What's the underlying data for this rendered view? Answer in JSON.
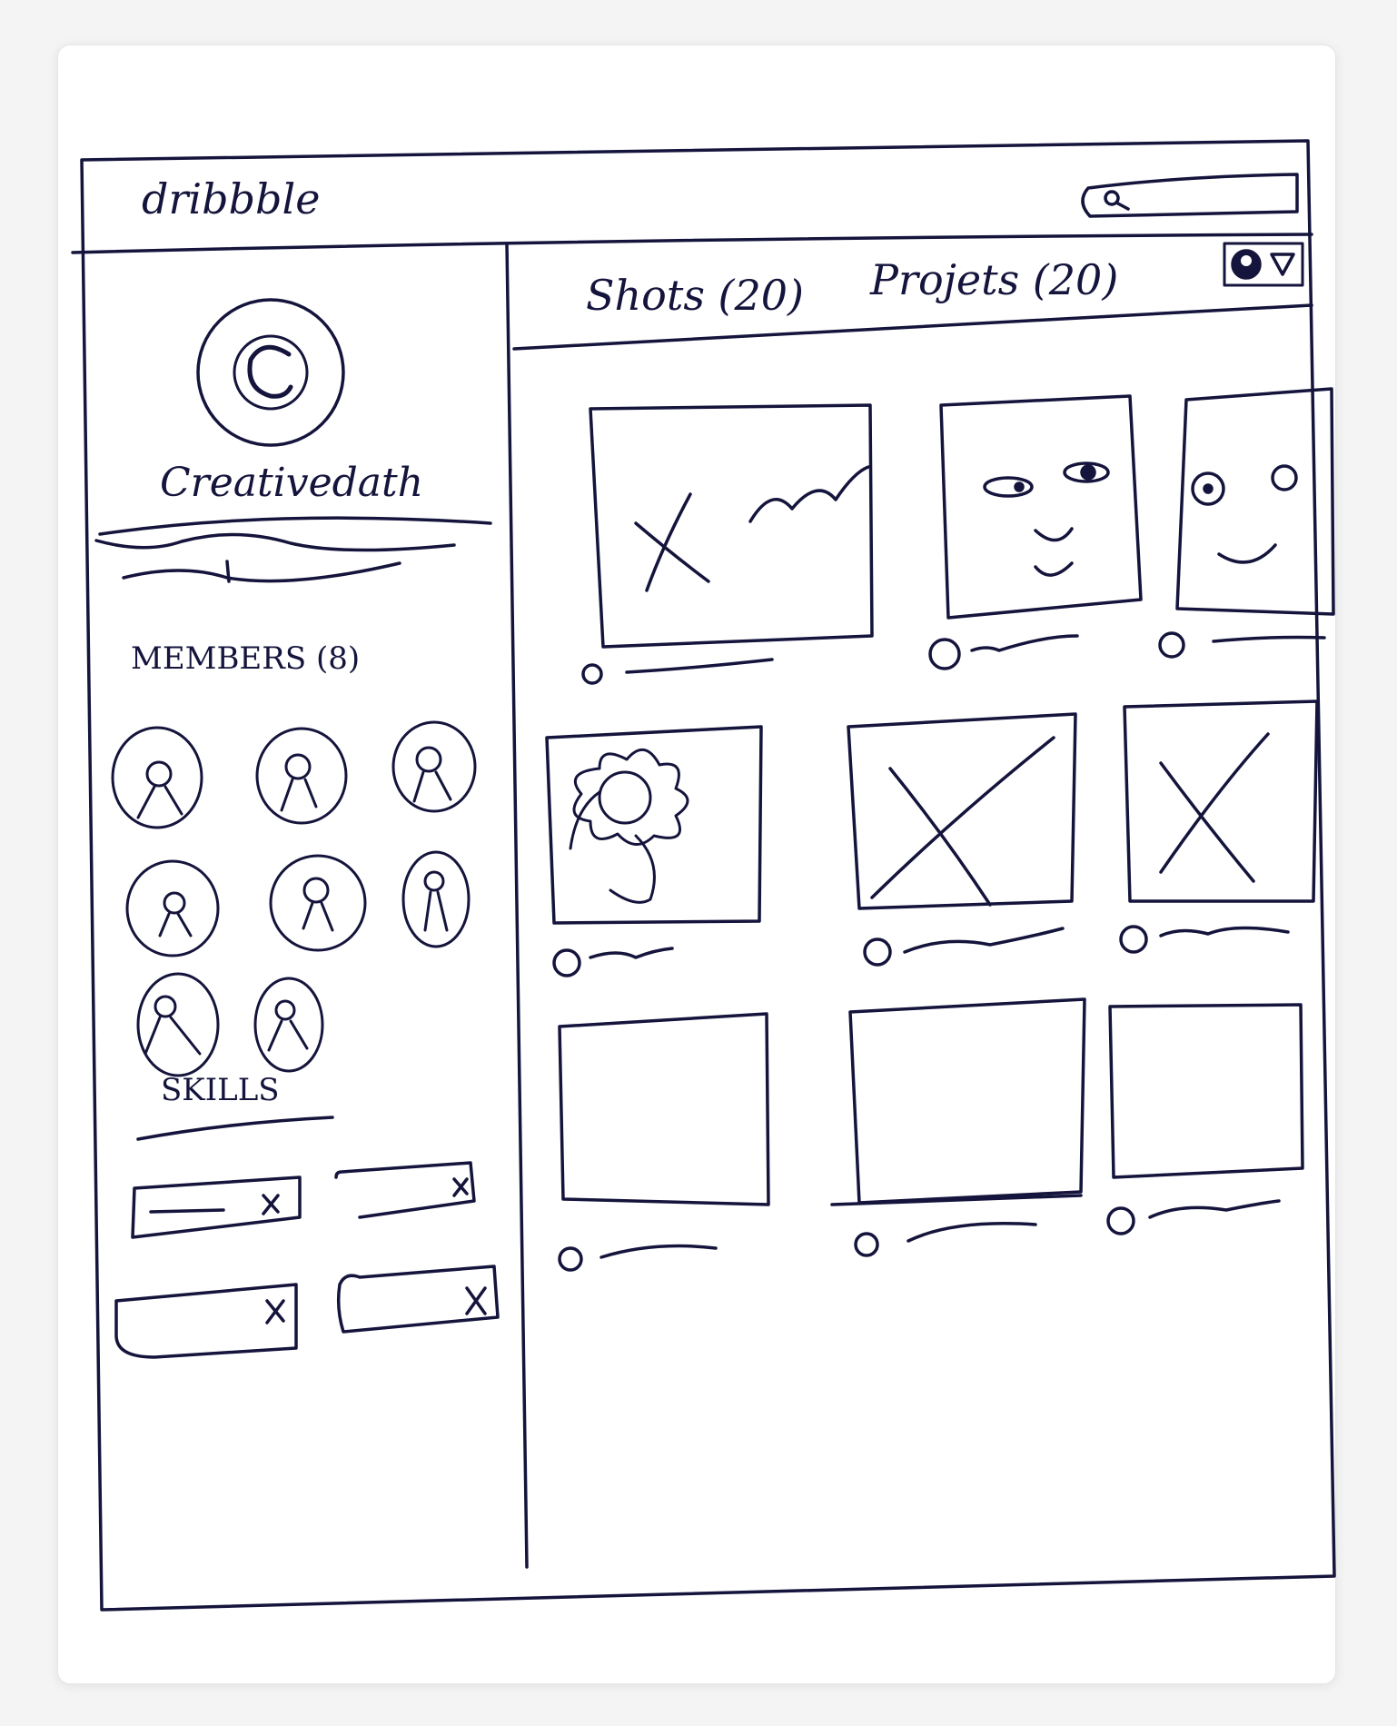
{
  "header": {
    "logo": "dribbble",
    "search_icon": "search-icon"
  },
  "profile": {
    "avatar_letter": "C",
    "username": "Creativedath"
  },
  "members": {
    "heading": "MEMBERS (8)",
    "count": 8,
    "avatar_icon": "person-icon"
  },
  "skills": {
    "heading": "SKILLS",
    "count": 4,
    "remove_icon": "close-icon"
  },
  "tabs": {
    "shots": "Shots (20)",
    "projects": "Projets (20)"
  },
  "account_menu": {
    "icons": [
      "avatar-icon",
      "dropdown-triangle-icon"
    ]
  },
  "shots_grid": {
    "rows": 3,
    "columns": 3,
    "thumbnail_icons": [
      "placeholder-x-scribble",
      "face-sketch",
      "face-sketch",
      "flower-sketch",
      "placeholder-x",
      "placeholder-x",
      "empty",
      "empty",
      "empty"
    ]
  },
  "colors": {
    "ink": "#14143c",
    "paper": "#ffffff",
    "background": "#f4f4f4"
  }
}
